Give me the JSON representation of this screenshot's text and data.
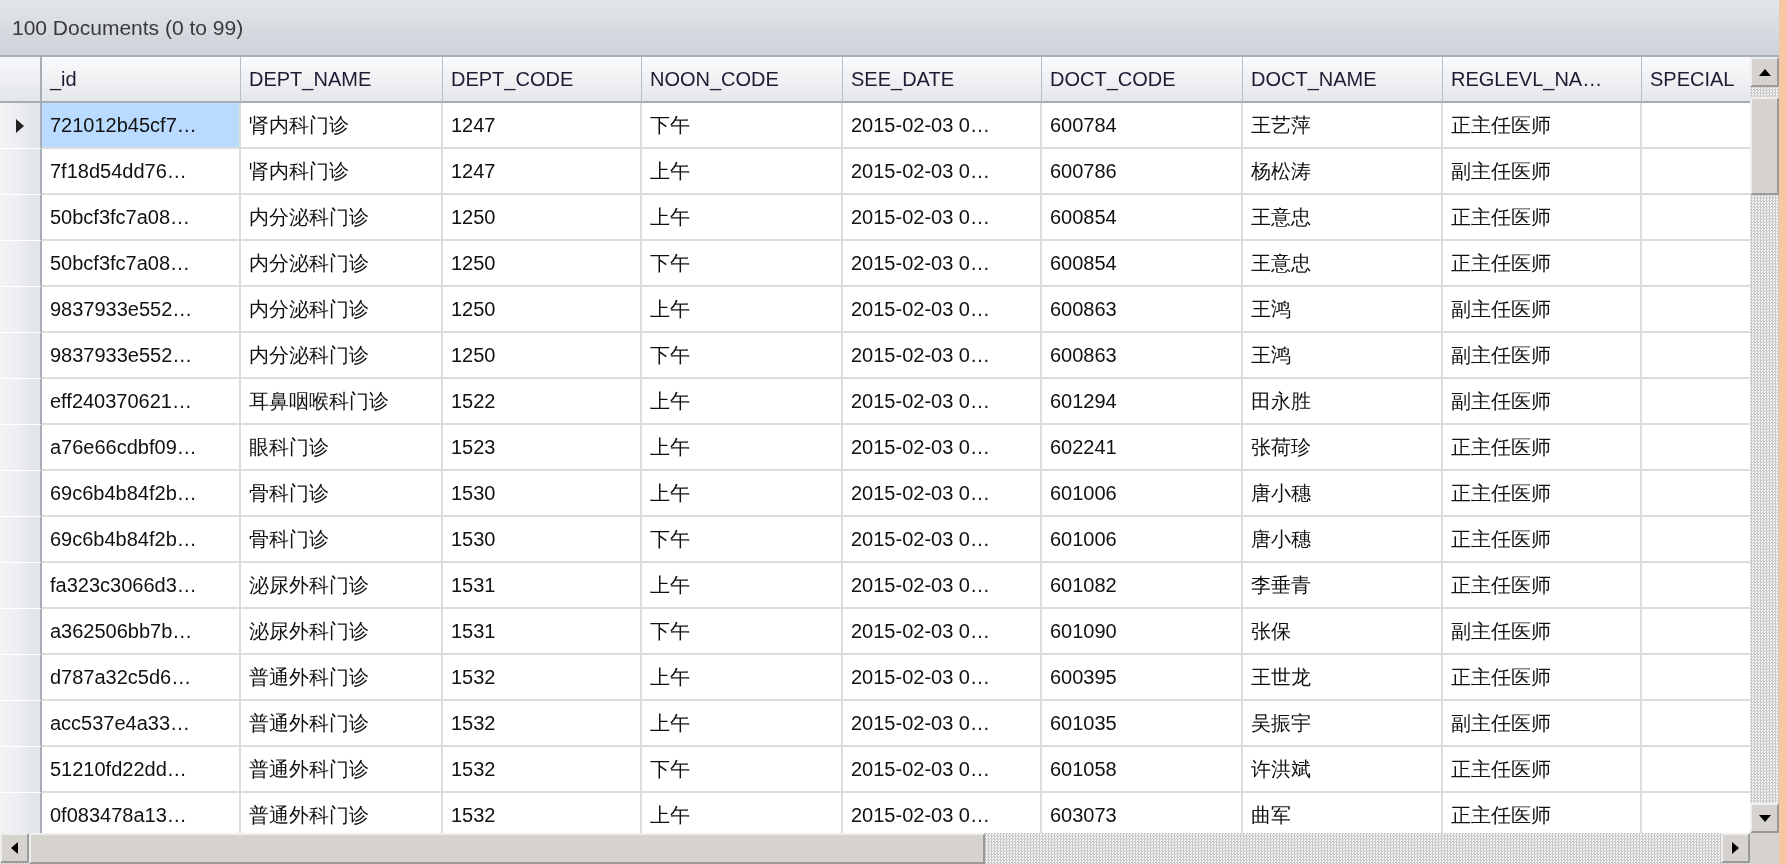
{
  "title": "100 Documents (0 to 99)",
  "columns": [
    "_id",
    "DEPT_NAME",
    "DEPT_CODE",
    "NOON_CODE",
    "SEE_DATE",
    "DOCT_CODE",
    "DOCT_NAME",
    "REGLEVL_NA…",
    "SPECIAL"
  ],
  "rows": [
    {
      "selected": true,
      "cells": [
        "721012b45cf7…",
        "肾内科门诊",
        "1247",
        "下午",
        "2015-02-03 0…",
        "600784",
        "王艺萍",
        "正主任医师"
      ]
    },
    {
      "selected": false,
      "cells": [
        "7f18d54dd76…",
        "肾内科门诊",
        "1247",
        "上午",
        "2015-02-03 0…",
        "600786",
        "杨松涛",
        "副主任医师"
      ]
    },
    {
      "selected": false,
      "cells": [
        "50bcf3fc7a08…",
        "内分泌科门诊",
        "1250",
        "上午",
        "2015-02-03 0…",
        "600854",
        "王意忠",
        "正主任医师"
      ]
    },
    {
      "selected": false,
      "cells": [
        "50bcf3fc7a08…",
        "内分泌科门诊",
        "1250",
        "下午",
        "2015-02-03 0…",
        "600854",
        "王意忠",
        "正主任医师"
      ]
    },
    {
      "selected": false,
      "cells": [
        "9837933e552…",
        "内分泌科门诊",
        "1250",
        "上午",
        "2015-02-03 0…",
        "600863",
        "王鸿",
        "副主任医师"
      ]
    },
    {
      "selected": false,
      "cells": [
        "9837933e552…",
        "内分泌科门诊",
        "1250",
        "下午",
        "2015-02-03 0…",
        "600863",
        "王鸿",
        "副主任医师"
      ]
    },
    {
      "selected": false,
      "cells": [
        "eff240370621…",
        "耳鼻咽喉科门诊",
        "1522",
        "上午",
        "2015-02-03 0…",
        "601294",
        "田永胜",
        "副主任医师"
      ]
    },
    {
      "selected": false,
      "cells": [
        "a76e66cdbf09…",
        "眼科门诊",
        "1523",
        "上午",
        "2015-02-03 0…",
        "602241",
        "张荷珍",
        "正主任医师"
      ]
    },
    {
      "selected": false,
      "cells": [
        "69c6b4b84f2b…",
        "骨科门诊",
        "1530",
        "上午",
        "2015-02-03 0…",
        "601006",
        "唐小穗",
        "正主任医师"
      ]
    },
    {
      "selected": false,
      "cells": [
        "69c6b4b84f2b…",
        "骨科门诊",
        "1530",
        "下午",
        "2015-02-03 0…",
        "601006",
        "唐小穗",
        "正主任医师"
      ]
    },
    {
      "selected": false,
      "cells": [
        "fa323c3066d3…",
        "泌尿外科门诊",
        "1531",
        "上午",
        "2015-02-03 0…",
        "601082",
        "李垂青",
        "正主任医师"
      ]
    },
    {
      "selected": false,
      "cells": [
        "a362506bb7b…",
        "泌尿外科门诊",
        "1531",
        "下午",
        "2015-02-03 0…",
        "601090",
        "张保",
        "副主任医师"
      ]
    },
    {
      "selected": false,
      "cells": [
        "d787a32c5d6…",
        "普通外科门诊",
        "1532",
        "上午",
        "2015-02-03 0…",
        "600395",
        "王世龙",
        "正主任医师"
      ]
    },
    {
      "selected": false,
      "cells": [
        "acc537e4a33…",
        "普通外科门诊",
        "1532",
        "上午",
        "2015-02-03 0…",
        "601035",
        "吴振宇",
        "副主任医师"
      ]
    },
    {
      "selected": false,
      "cells": [
        "51210fd22dd…",
        "普通外科门诊",
        "1532",
        "下午",
        "2015-02-03 0…",
        "601058",
        "许洪斌",
        "正主任医师"
      ]
    },
    {
      "selected": false,
      "cells": [
        "0f083478a13…",
        "普通外科门诊",
        "1532",
        "上午",
        "2015-02-03 0…",
        "603073",
        "曲军",
        "正主任医师"
      ]
    }
  ]
}
